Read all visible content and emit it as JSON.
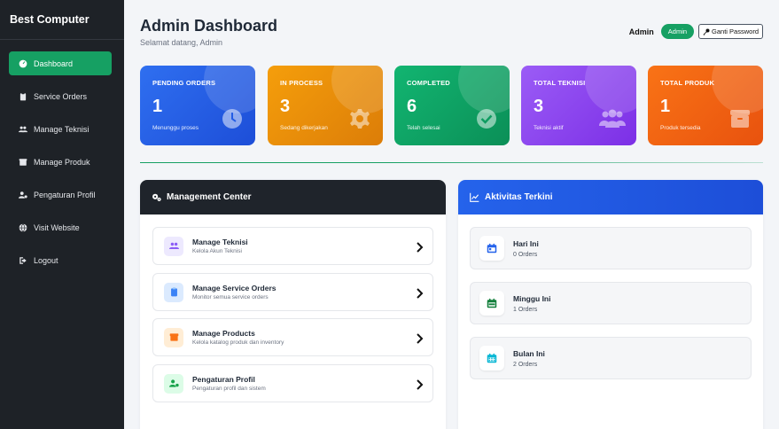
{
  "sidebar": {
    "brand": "Best Computer",
    "items": [
      {
        "label": "Dashboard",
        "icon": "dashboard-icon",
        "active": true
      },
      {
        "label": "Service Orders",
        "icon": "clipboard-icon",
        "active": false
      },
      {
        "label": "Manage Teknisi",
        "icon": "users-icon",
        "active": false
      },
      {
        "label": "Manage Produk",
        "icon": "box-icon",
        "active": false
      },
      {
        "label": "Pengaturan Profil",
        "icon": "user-cog-icon",
        "active": false
      },
      {
        "label": "Visit Website",
        "icon": "globe-icon",
        "active": false
      },
      {
        "label": "Logout",
        "icon": "logout-icon",
        "active": false
      }
    ]
  },
  "header": {
    "title": "Admin Dashboard",
    "subtitle": "Selamat datang, Admin",
    "user_label": "Admin",
    "role_badge": "Admin",
    "password_button": "Ganti Password"
  },
  "stats": [
    {
      "label": "PENDING ORDERS",
      "value": "1",
      "caption": "Menunggu proses",
      "icon": "clock-icon",
      "color": "#2563eb"
    },
    {
      "label": "IN PROCESS",
      "value": "3",
      "caption": "Sedang dikerjakan",
      "icon": "gear-icon",
      "color": "#e8890c"
    },
    {
      "label": "COMPLETED",
      "value": "6",
      "caption": "Telah selesai",
      "icon": "check-circle-icon",
      "color": "#10a064"
    },
    {
      "label": "TOTAL TEKNISI",
      "value": "3",
      "caption": "Teknisi aktif",
      "icon": "users-icon",
      "color": "#8b3df0"
    },
    {
      "label": "TOTAL PRODUK",
      "value": "1",
      "caption": "Produk tersedia",
      "icon": "box-icon",
      "color": "#f26516"
    }
  ],
  "management": {
    "title": "Management Center",
    "items": [
      {
        "title": "Manage Teknisi",
        "subtitle": "Kelola Akun Teknisi",
        "icon": "users-icon",
        "color": "#8b5cf6"
      },
      {
        "title": "Manage Service Orders",
        "subtitle": "Monitor semua service orders",
        "icon": "clipboard-icon",
        "color": "#3b82f6"
      },
      {
        "title": "Manage Products",
        "subtitle": "Kelola katalog produk dan inventory",
        "icon": "box-icon",
        "color": "#f97316"
      },
      {
        "title": "Pengaturan Profil",
        "subtitle": "Pengaturan profil dan sistem",
        "icon": "user-cog-icon",
        "color": "#16a34a"
      }
    ]
  },
  "activity": {
    "title": "Aktivitas Terkini",
    "items": [
      {
        "title": "Hari Ini",
        "count": "0 Orders",
        "icon": "calendar-day-icon",
        "color": "#2563eb"
      },
      {
        "title": "Minggu Ini",
        "count": "1 Orders",
        "icon": "calendar-week-icon",
        "color": "#15803d"
      },
      {
        "title": "Bulan Ini",
        "count": "2 Orders",
        "icon": "calendar-month-icon",
        "color": "#06b6d4"
      }
    ]
  }
}
